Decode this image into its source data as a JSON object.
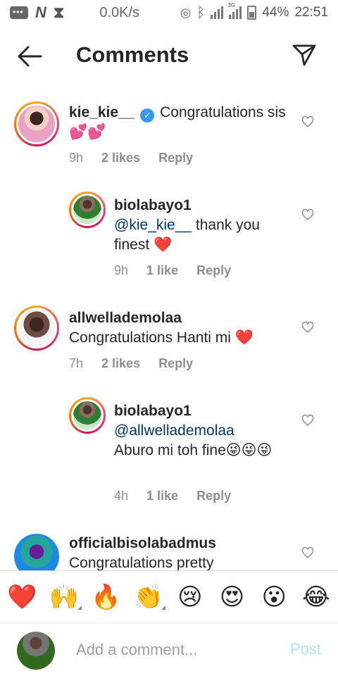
{
  "status_bar": {
    "speed": "0.0K/s",
    "signal_label": "3G",
    "battery": "44%",
    "time": "22:51"
  },
  "header": {
    "title": "Comments"
  },
  "comments": [
    {
      "username": "kie_kie__",
      "verified": true,
      "text": "Congratulations sis 💕💕",
      "time": "9h",
      "likes": "2 likes",
      "reply": "Reply"
    },
    {
      "username": "biolabayo1",
      "mention": "@kie_kie__",
      "text": " thank you finest ❤️",
      "time": "9h",
      "likes": "1 like",
      "reply": "Reply"
    },
    {
      "username": "allwellademolaa",
      "text": "Congratulations Hanti mi ❤️",
      "time": "7h",
      "likes": "2 likes",
      "reply": "Reply"
    },
    {
      "username": "biolabayo1",
      "mention": "@allwellademolaa",
      "text": "Aburo mi toh fine😜😜😜",
      "time": "4h",
      "likes": "1 like",
      "reply": "Reply"
    },
    {
      "username": "officialbisolabadmus",
      "text": "Congratulations pretty"
    }
  ],
  "emoji_bar": [
    "❤️",
    "🙌",
    "🔥",
    "👏",
    "😢",
    "😍",
    "😮",
    "😂"
  ],
  "input": {
    "placeholder": "Add a comment...",
    "post_label": "Post"
  },
  "colors": {
    "link": "#00376b",
    "verified": "#3897f0",
    "post_disabled": "#b2dffc",
    "heart": "#ed4956"
  }
}
